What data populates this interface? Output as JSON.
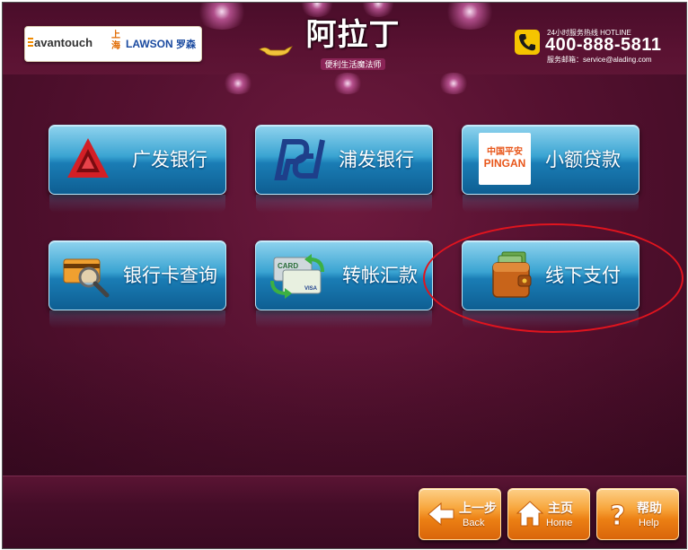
{
  "header": {
    "logo_avantouch": "avantouch",
    "logo_shanghai": "上海",
    "logo_lawson": "LAWSON",
    "logo_lawson_cn": "罗森",
    "brand_title": "阿拉丁",
    "brand_subtitle": "便利生活魔法师",
    "hotline_label": "24小时服务热线 HOTLINE",
    "hotline_number": "400-888-5811",
    "email_line": "服务邮箱：service@alading.com"
  },
  "tiles": [
    {
      "label": "广发银行",
      "icon": "cgb-logo-icon"
    },
    {
      "label": "浦发银行",
      "icon": "spdb-logo-icon"
    },
    {
      "label": "小额贷款",
      "icon": "pingan-logo-icon",
      "icon_text_top": "中国平安",
      "icon_text_bottom": "PINGAN"
    },
    {
      "label": "银行卡查询",
      "icon": "card-magnifier-icon"
    },
    {
      "label": "转帐汇款",
      "icon": "card-transfer-icon",
      "card_text": "CARD",
      "card_brand": "VISA"
    },
    {
      "label": "线下支付",
      "icon": "wallet-icon"
    }
  ],
  "nav": {
    "back_zh": "上一步",
    "back_en": "Back",
    "home_zh": "主页",
    "home_en": "Home",
    "help_zh": "帮助",
    "help_en": "Help"
  },
  "colors": {
    "background": "#551130",
    "tile": "#1a7db5",
    "nav_button": "#ec8014",
    "highlight": "#e0141e"
  }
}
